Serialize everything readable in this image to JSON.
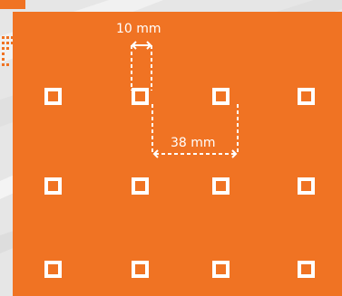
{
  "colors": {
    "panel": "#f07323",
    "hole_border": "#ffffff",
    "dimension_line": "#ffffff",
    "background": "#e9e9e9",
    "accent_dots": "#f07323"
  },
  "dimensions": {
    "hole_size": {
      "label": "10 mm",
      "value": 10,
      "unit": "mm"
    },
    "hole_spacing": {
      "label": "38 mm",
      "value": 38,
      "unit": "mm"
    }
  },
  "grid": {
    "rows": 3,
    "columns": 4
  }
}
